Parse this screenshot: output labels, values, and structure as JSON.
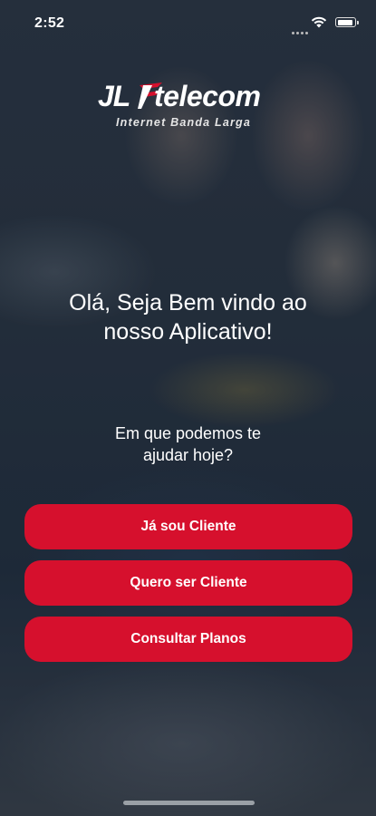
{
  "status_bar": {
    "time": "2:52"
  },
  "brand": {
    "logo_main": "JL",
    "logo_suffix": "telecom",
    "tagline": "Internet Banda Larga",
    "accent": "#d6102d"
  },
  "welcome": {
    "line1": "Olá, Seja Bem vindo ao",
    "line2": "nosso Aplicativo!"
  },
  "question": {
    "line1": "Em que podemos te",
    "line2": "ajudar hoje?"
  },
  "buttons": {
    "existing_client": "Já sou Cliente",
    "become_client": "Quero ser Cliente",
    "view_plans": "Consultar Planos"
  },
  "icons": [
    "signal-dots-icon",
    "wifi-icon",
    "battery-icon"
  ]
}
